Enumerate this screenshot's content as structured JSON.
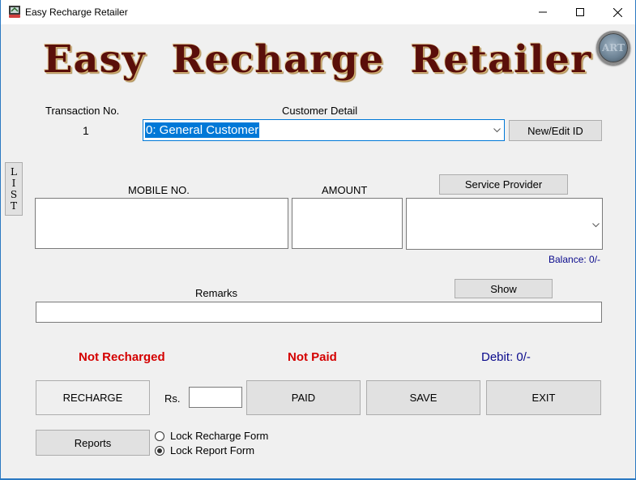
{
  "window": {
    "title": "Easy Recharge Retailer",
    "controls": {
      "minimize": "—",
      "maximize": "☐",
      "close": "✕"
    }
  },
  "header": {
    "logo_text": "Easy Recharge Retailer",
    "badge_text": "ART"
  },
  "transaction": {
    "label": "Transaction No.",
    "value": "1"
  },
  "customer": {
    "label": "Customer Detail",
    "selected": "0: General Customer",
    "new_edit_button": "New/Edit ID"
  },
  "list_button": {
    "letters": [
      "L",
      "I",
      "S",
      "T"
    ]
  },
  "mobile": {
    "label": "MOBILE NO.",
    "value": ""
  },
  "amount": {
    "label": "AMOUNT",
    "value": ""
  },
  "service_provider": {
    "button": "Service Provider",
    "selected": "",
    "balance": "Balance: 0/-"
  },
  "remarks": {
    "label": "Remarks",
    "value": "",
    "show_button": "Show"
  },
  "status": {
    "recharge": "Not Recharged",
    "payment": "Not Paid",
    "debit": "Debit: 0/-"
  },
  "actions": {
    "recharge": "RECHARGE",
    "rs_label": "Rs.",
    "rs_value": "",
    "paid": "PAID",
    "save": "SAVE",
    "exit": "EXIT",
    "reports": "Reports"
  },
  "lock_options": [
    {
      "label": "Lock Recharge Form",
      "checked": false
    },
    {
      "label": "Lock Report Form",
      "checked": true
    }
  ],
  "colors": {
    "status_red": "#d40000",
    "info_blue": "#0a0a8c",
    "selection_blue": "#0078d7",
    "logo_maroon": "#5a0f0a"
  }
}
